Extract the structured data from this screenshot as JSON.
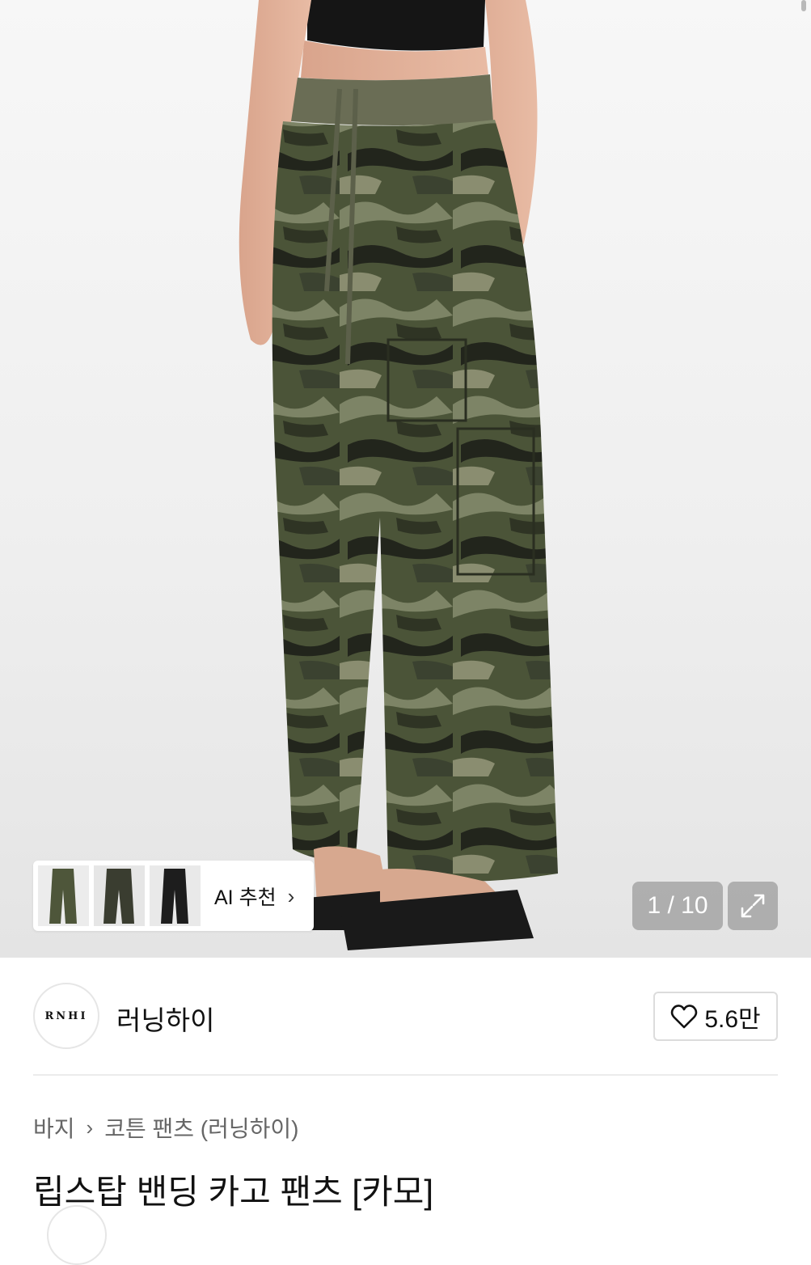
{
  "gallery": {
    "ai_recommend_label": "AI 추천",
    "ai_recommend_chevron": "chevron-right-icon",
    "page_counter": "1 / 10",
    "expand_icon": "expand-icon",
    "thumbnails": [
      "product-thumbnail-1",
      "product-thumbnail-2",
      "product-thumbnail-3"
    ]
  },
  "brand": {
    "logo_text": "RNHI",
    "name": "러닝하이",
    "like_icon": "heart-outline-icon",
    "like_count": "5.6만"
  },
  "breadcrumb": {
    "items": [
      "바지",
      "코튼 팬츠 (러닝하이)"
    ],
    "separator_icon": "chevron-right-icon"
  },
  "product": {
    "title": "립스탑 밴딩 카고 팬츠 [카모]"
  },
  "colors": {
    "camo_base": "#4b5438",
    "camo_light": "#7d8466",
    "camo_dark": "#22251c",
    "overlay": "#8a8a8a"
  }
}
